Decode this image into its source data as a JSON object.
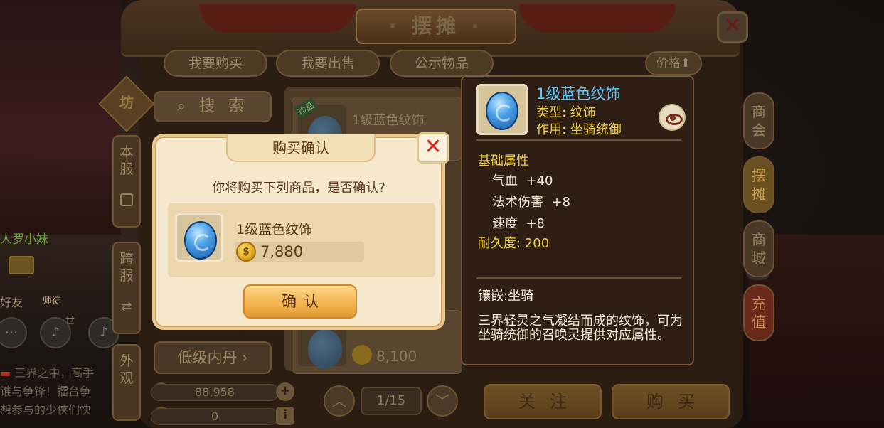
{
  "background": {
    "player_name_fragment": "人罗小妹",
    "friend_label": "好友",
    "mentor_label": "师徒",
    "world_label": "世",
    "chat_lines": [
      {
        "tag": "",
        "text": "三界之中，高手"
      },
      {
        "tag": "",
        "text": "谁与争锋！擂台争"
      },
      {
        "tag": "",
        "text": "想参与的少侠们快"
      }
    ]
  },
  "window": {
    "title": "摆摊",
    "close_glyph": "✕"
  },
  "tabs": {
    "buy": "我要购买",
    "sell": "我要出售",
    "public": "公示物品",
    "price_sort": "价格⬆"
  },
  "left_tabs": {
    "badge": "坊",
    "this_server": "本服",
    "cross_server": "跨服",
    "appearance": "外观"
  },
  "left_panel": {
    "search_label": "搜 索",
    "category_low_inner_dan": "低级内丹 ›"
  },
  "money": {
    "silver": "88,958",
    "gold": "0",
    "plus": "+",
    "info": "i"
  },
  "list_items": [
    {
      "name": "1级蓝色纹饰",
      "price": "",
      "tag": "珍品"
    },
    {
      "name": "",
      "price": "8,100",
      "tag": ""
    }
  ],
  "pager": {
    "page": "1/15",
    "up": "︿",
    "down": "﹀"
  },
  "bottom_buttons": {
    "follow": "关注",
    "buy": "购买"
  },
  "side_tabs": [
    "商会",
    "摆摊",
    "商城",
    "充值"
  ],
  "tooltip": {
    "name": "1级蓝色纹饰",
    "type": "类型: 纹饰",
    "use": "作用: 坐骑统御",
    "base_attr_title": "基础属性",
    "attrs": [
      {
        "label": "气血",
        "value": "+40"
      },
      {
        "label": "法术伤害",
        "value": "+8"
      },
      {
        "label": "速度",
        "value": "+8"
      }
    ],
    "durability": "耐久度: 200",
    "inlay": "镶嵌:坐骑",
    "description": "三界轻灵之气凝结而成的纹饰，可为坐骑统御的召唤灵提供对应属性。"
  },
  "dialog": {
    "title": "购买确认",
    "message": "你将购买下列商品，是否确认?",
    "item_name": "1级蓝色纹饰",
    "price": "7,880",
    "confirm": "确认",
    "close_glyph": "✕"
  },
  "colors": {
    "tooltip_name": "#58c8ff",
    "tooltip_gold": "#f0d040",
    "dialog_close": "#d8261c",
    "confirm_button": "#f3b552"
  }
}
